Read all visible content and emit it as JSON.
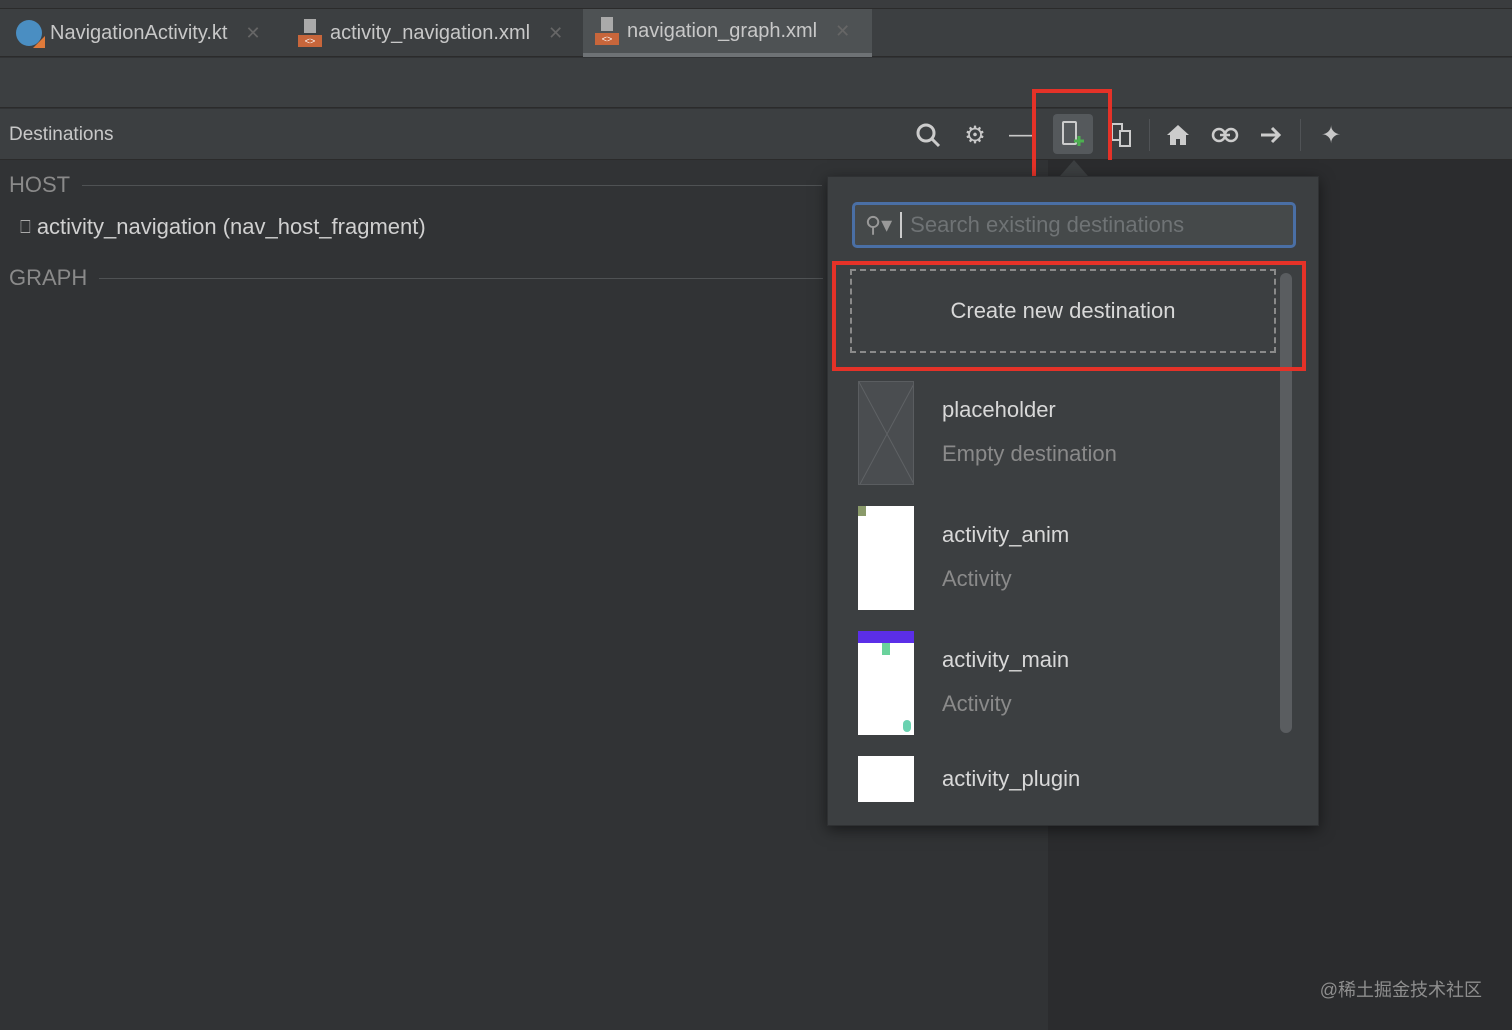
{
  "tabs": [
    {
      "label": "NavigationActivity.kt",
      "icon": "kotlin-file-icon",
      "active": false
    },
    {
      "label": "activity_navigation.xml",
      "icon": "xml-file-icon",
      "active": false
    },
    {
      "label": "navigation_graph.xml",
      "icon": "xml-file-icon",
      "active": true
    }
  ],
  "toolbar": {
    "title": "Destinations",
    "icons": [
      "search-icon",
      "gear-icon",
      "minus-icon",
      "new-destination-icon",
      "nested-graph-icon",
      "home-icon",
      "link-icon",
      "arrow-right-icon",
      "auto-arrange-icon"
    ]
  },
  "panel": {
    "host_label": "HOST",
    "host_item": "activity_navigation (nav_host_fragment)",
    "graph_label": "GRAPH"
  },
  "popup": {
    "search_placeholder": "Search existing destinations",
    "create_label": "Create new destination",
    "items": [
      {
        "name": "placeholder",
        "type": "Empty destination"
      },
      {
        "name": "activity_anim",
        "type": "Activity"
      },
      {
        "name": "activity_main",
        "type": "Activity"
      },
      {
        "name": "activity_plugin",
        "type": ""
      }
    ]
  },
  "watermark": "@稀土掘金技术社区",
  "colors": {
    "highlight": "#e53228",
    "focus": "#4a6fa5",
    "accent_purple": "#5b2ee8"
  }
}
